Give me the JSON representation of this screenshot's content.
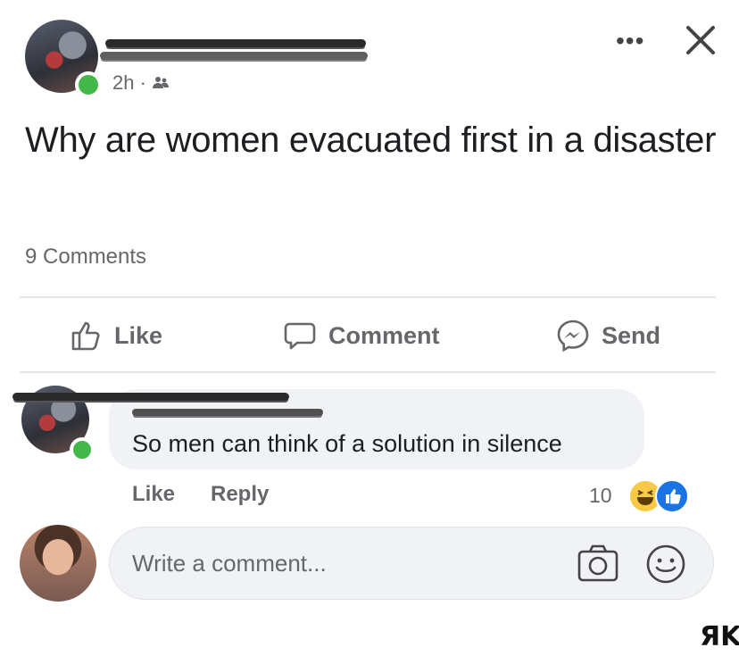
{
  "post": {
    "time": "2h ·",
    "text": "Why are women evacuated first in a disaster",
    "comments_count": "9 Comments"
  },
  "actions": {
    "like": "Like",
    "comment": "Comment",
    "send": "Send"
  },
  "comment": {
    "text": "So men can think of a solution in silence",
    "like": "Like",
    "reply": "Reply",
    "reaction_count": "10",
    "reactions": [
      "haha-icon",
      "like-icon"
    ]
  },
  "composer": {
    "placeholder": "Write a comment..."
  },
  "watermark": "ЯK",
  "colors": {
    "online": "#44b74a",
    "bubble": "#f0f2f5",
    "muted_text": "#65676b",
    "like_blue": "#1b74e4"
  }
}
